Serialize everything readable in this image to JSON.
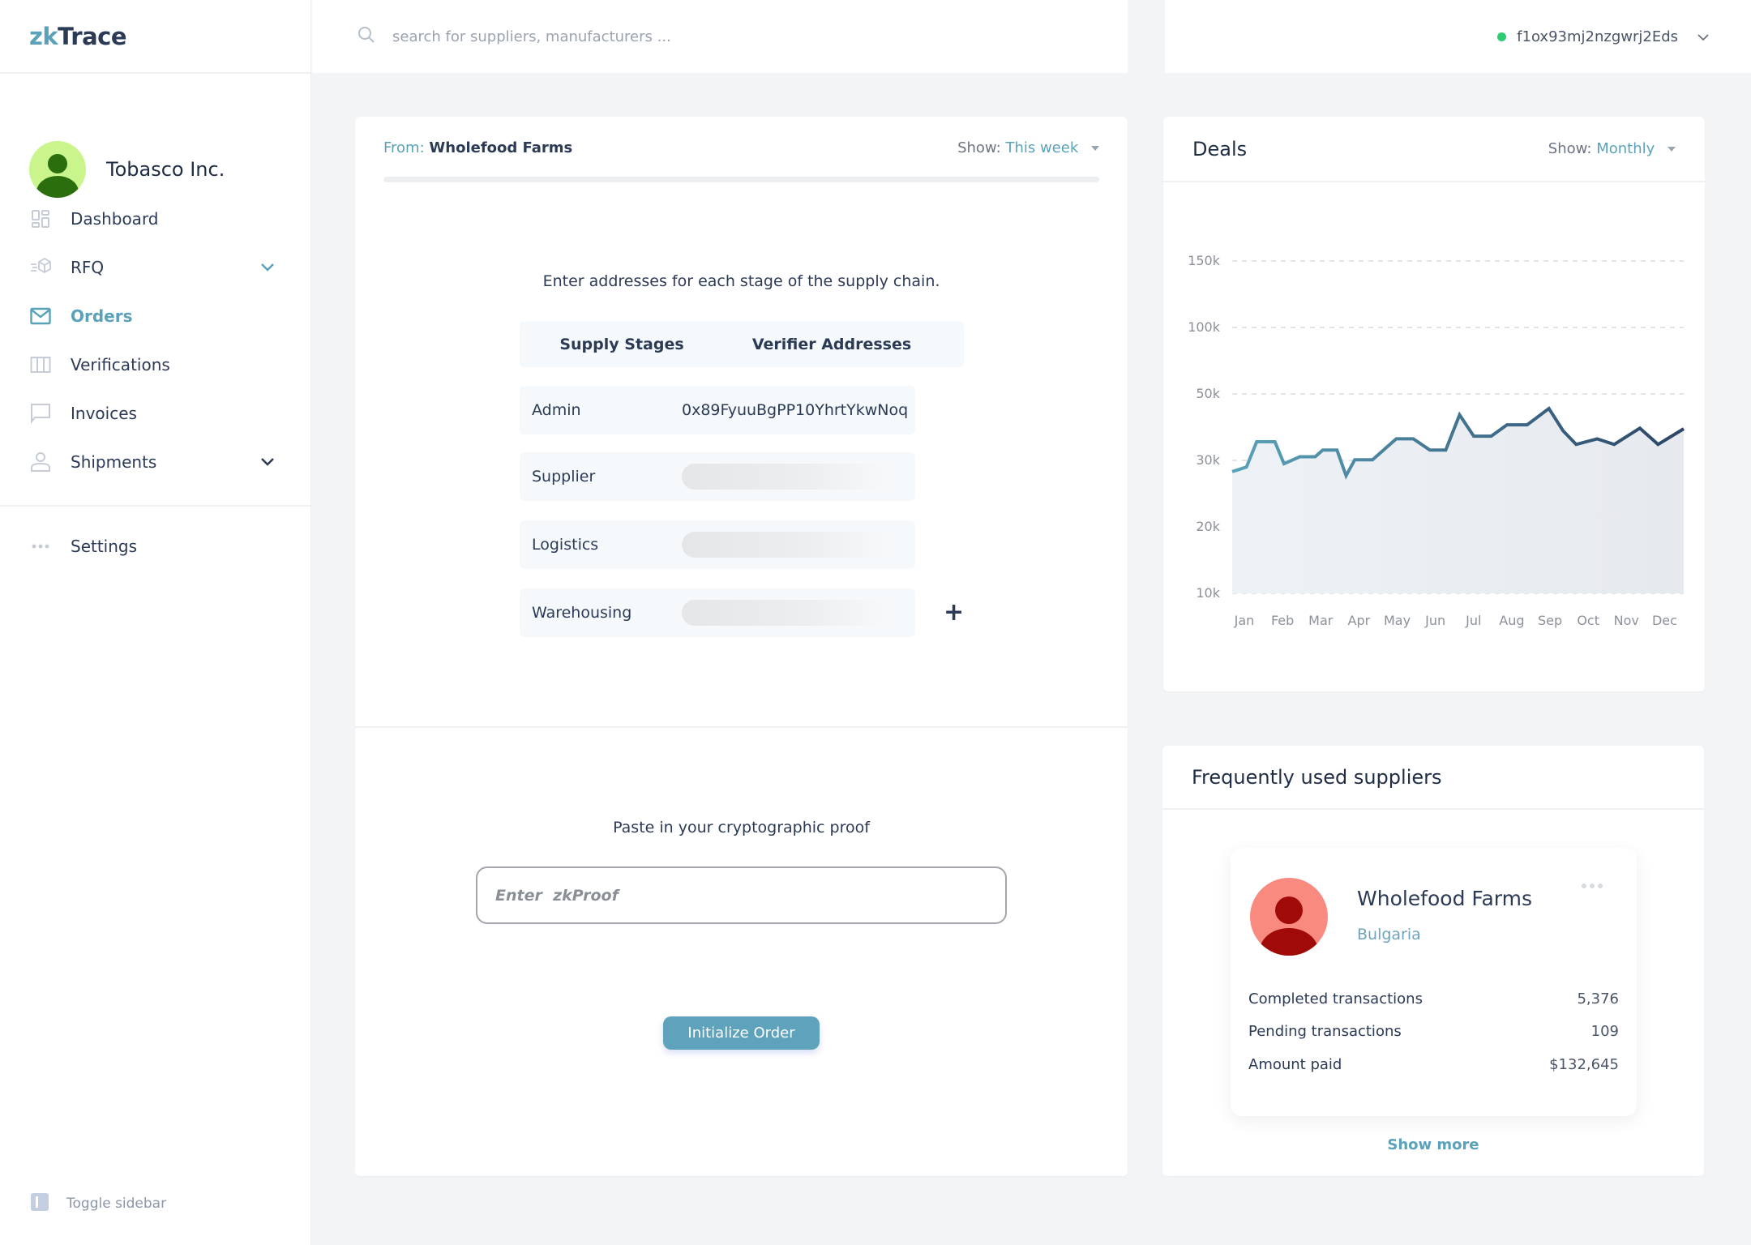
{
  "app": {
    "logo_prefix": "zk",
    "logo_suffix": "Trace"
  },
  "profile": {
    "name": "Tobasco Inc.",
    "avatar_color": "#c9f58c"
  },
  "sidebar": {
    "items": [
      {
        "label": "Dashboard",
        "icon": "dashboard-grid-icon",
        "active": false,
        "has_chevron": false
      },
      {
        "label": "RFQ",
        "icon": "box-icon",
        "active": false,
        "has_chevron": true
      },
      {
        "label": "Orders",
        "icon": "envelope-icon",
        "active": true,
        "has_chevron": false
      },
      {
        "label": "Verifications",
        "icon": "columns-icon",
        "active": false,
        "has_chevron": false
      },
      {
        "label": "Invoices",
        "icon": "chat-bubble-icon",
        "active": false,
        "has_chevron": false
      },
      {
        "label": "Shipments",
        "icon": "user-icon",
        "active": false,
        "has_chevron": true
      }
    ],
    "settings_label": "Settings",
    "toggle_label": "Toggle sidebar"
  },
  "search": {
    "placeholder": "search for suppliers, manufacturers ...",
    "value": ""
  },
  "wallet": {
    "address": "f1ox93mj2nzgwrj2Eds",
    "status_color": "#2ecc71"
  },
  "order_card": {
    "from_label": "From:",
    "from_value": "Wholefood Farms",
    "show_label": "Show:",
    "show_value": "This week",
    "instruction": "Enter addresses for each stage of the supply chain.",
    "columns": [
      "Supply Stages",
      "Verifier Addresses"
    ],
    "stages": [
      {
        "name": "Admin",
        "address": "0x89FyuuBgPP10YhrtYkwNoq"
      },
      {
        "name": "Supplier",
        "address": ""
      },
      {
        "name": "Logistics",
        "address": ""
      },
      {
        "name": "Warehousing",
        "address": ""
      }
    ],
    "add_stage_label": "+",
    "proof_label": "Paste in your cryptographic proof",
    "proof_placeholder": "Enter  zkProof",
    "proof_value": "",
    "submit_label": "Initialize Order"
  },
  "deals": {
    "title": "Deals",
    "show_label": "Show:",
    "show_value": "Monthly"
  },
  "chart_data": {
    "type": "area",
    "title": "Deals",
    "xlabel": "",
    "ylabel": "",
    "categories": [
      "Jan",
      "Feb",
      "Mar",
      "Apr",
      "May",
      "Jun",
      "Jul",
      "Aug",
      "Sep",
      "Oct",
      "Nov",
      "Dec"
    ],
    "y_ticks": [
      "10k",
      "20k",
      "30k",
      "50k",
      "100k",
      "150k"
    ],
    "y_tick_values": [
      10000,
      20000,
      30000,
      50000,
      100000,
      150000
    ],
    "y_scale": "piecewise-linear between listed ticks (ticks equally spaced)",
    "ylim": [
      10000,
      150000
    ],
    "grid": true,
    "legend": "none",
    "series": [
      {
        "name": "Deals",
        "x": [
          0.0,
          0.36,
          0.62,
          1.08,
          1.31,
          1.71,
          2.1,
          2.29,
          2.65,
          2.88,
          3.1,
          3.55,
          4.15,
          4.58,
          5.0,
          5.4,
          5.75,
          6.11,
          6.55,
          6.95,
          7.46,
          8.01,
          8.37,
          8.7,
          9.23,
          9.66,
          10.31,
          10.77,
          11.42
        ],
        "values": [
          28300,
          29000,
          35600,
          35600,
          29500,
          31100,
          31100,
          33100,
          33100,
          27700,
          30200,
          30200,
          36500,
          36500,
          33100,
          33100,
          43700,
          37300,
          37300,
          40700,
          40700,
          45600,
          38900,
          34800,
          36500,
          34800,
          39700,
          34800,
          39500
        ]
      }
    ],
    "line_color_start": "#5aa2ba",
    "line_color_end": "#2c4566"
  },
  "suppliers": {
    "title": "Frequently used suppliers",
    "items": [
      {
        "name": "Wholefood Farms",
        "country": "Bulgaria",
        "avatar_color": "#f98a80",
        "stats": [
          {
            "label": "Completed transactions",
            "value": "5,376"
          },
          {
            "label": "Pending transactions",
            "value": "109"
          },
          {
            "label": "Amount paid",
            "value": "$132,645"
          }
        ]
      }
    ],
    "show_more_label": "Show more"
  }
}
